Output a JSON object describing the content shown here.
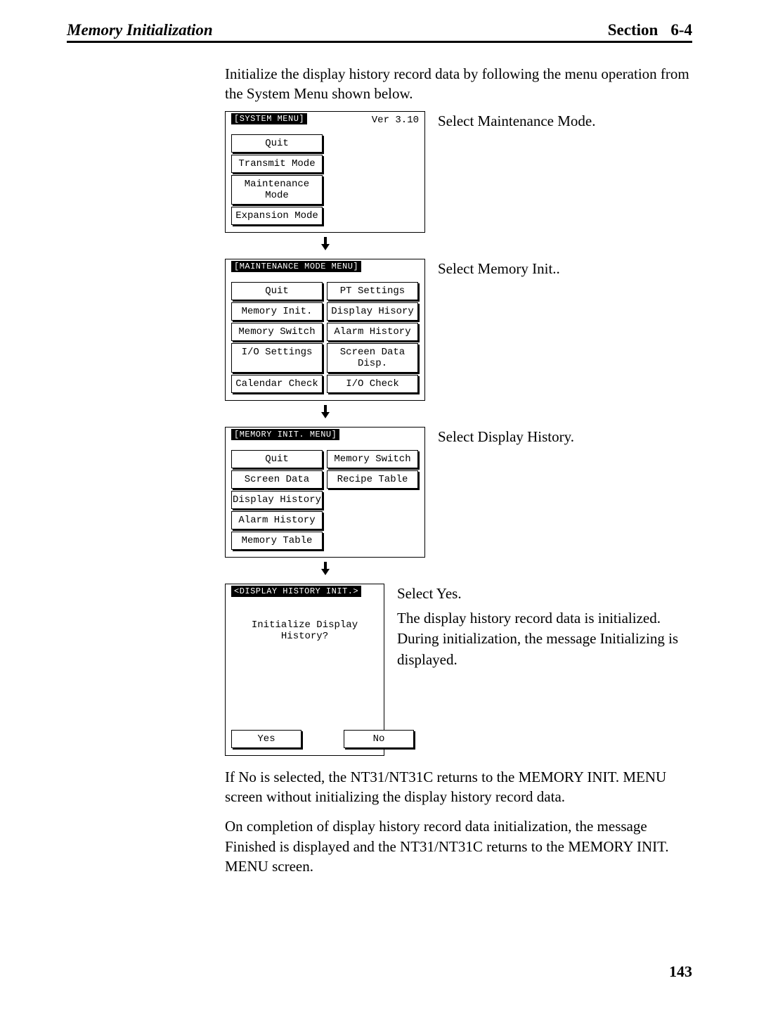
{
  "header": {
    "left": "Memory Initialization",
    "section_label": "Section",
    "section_number": "6-4"
  },
  "intro": "Initialize the display history record data by following the menu operation from the System Menu shown below.",
  "panel1": {
    "title": "[SYSTEM MENU]",
    "version": "Ver 3.10",
    "buttons": [
      "Quit",
      "Transmit Mode",
      "Maintenance Mode",
      "Expansion Mode"
    ],
    "desc": "Select Maintenance Mode."
  },
  "panel2": {
    "title": "[MAINTENANCE MODE MENU]",
    "left": [
      "Quit",
      "Memory Init.",
      "Memory Switch",
      "I/O Settings",
      "Calendar Check"
    ],
    "right": [
      "PT Settings",
      "Display Hisory",
      "Alarm History",
      "Screen Data Disp.",
      "I/O Check"
    ],
    "desc": "Select Memory Init.."
  },
  "panel3": {
    "title": "[MEMORY INIT. MENU]",
    "left": [
      "Quit",
      "Screen Data",
      "Display History",
      "Alarm History",
      "Memory Table"
    ],
    "right": [
      "Memory Switch",
      "Recipe Table"
    ],
    "desc": "Select Display History."
  },
  "panel4": {
    "title": "<DISPLAY HISTORY INIT.>",
    "prompt": "Initialize Display History?",
    "yes": "Yes",
    "no": "No",
    "desc1": "Select Yes.",
    "desc2": "The display history record data is initialized. During initialization, the message Initializing is displayed."
  },
  "follow1": "If No is selected, the NT31/NT31C returns to the MEMORY INIT. MENU screen without initializing the display history record data.",
  "follow2": "On completion of display history record data initialization, the message Finished is displayed and the NT31/NT31C returns to the MEMORY INIT. MENU screen.",
  "page_number": "143"
}
